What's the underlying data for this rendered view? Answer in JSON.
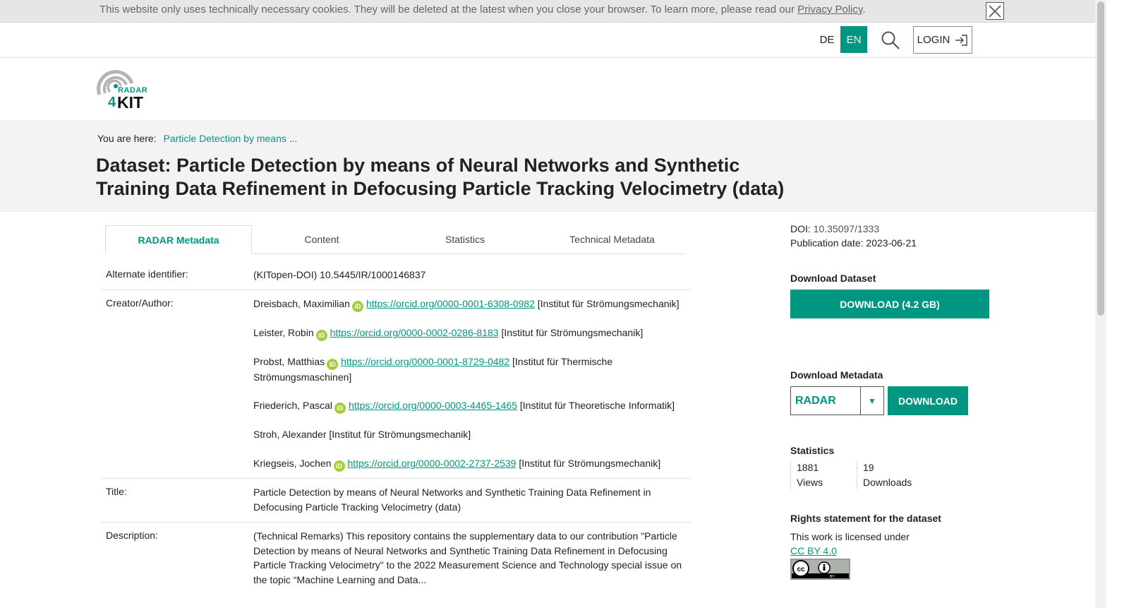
{
  "cookie": {
    "text": "This website only uses technically necessary cookies. They will be deleted at the latest when you close your browser. To learn more, please read our ",
    "link": "Privacy Policy",
    "suffix": "."
  },
  "topbar": {
    "lang_de": "DE",
    "lang_en": "EN",
    "login": "LOGIN"
  },
  "logo": {
    "line1": "RADAR",
    "line2a": "4",
    "line2b": "KIT"
  },
  "breadcrumb": {
    "prefix": "You are here:",
    "current": "Particle Detection by means",
    "ellipsis": "..."
  },
  "page_title": "Dataset: Particle Detection by means of Neural Networks and Synthetic Training Data Refinement in Defocusing Particle Tracking Velocimetry (data)",
  "tabs": [
    "RADAR Metadata",
    "Content",
    "Statistics",
    "Technical Metadata"
  ],
  "metadata": {
    "alternate_identifier_label": "Alternate identifier:",
    "alternate_identifier": "(KITopen-DOI) 10.5445/IR/1000146837",
    "creator_label": "Creator/Author:",
    "creators": [
      {
        "name": "Dreisbach, Maximilian",
        "orcid": "https://orcid.org/0000-0001-6308-0982",
        "affiliation": "[Institut für Strömungsmechanik]"
      },
      {
        "name": "Leister, Robin",
        "orcid": "https://orcid.org/0000-0002-0286-8183",
        "affiliation": "[Institut für Strömungsmechanik]"
      },
      {
        "name": "Probst, Matthias",
        "orcid": "https://orcid.org/0000-0001-8729-0482",
        "affiliation": "[Institut für Thermische Strömungsmaschinen]"
      },
      {
        "name": "Friederich, Pascal",
        "orcid": "https://orcid.org/0000-0003-4465-1465",
        "affiliation": "[Institut für Theoretische Informatik]"
      },
      {
        "name": "Stroh, Alexander",
        "orcid": "",
        "affiliation": "[Institut für Strömungsmechanik]"
      },
      {
        "name": "Kriegseis, Jochen",
        "orcid": "https://orcid.org/0000-0002-2737-2539",
        "affiliation": "[Institut für Strömungsmechanik]"
      }
    ],
    "title_label": "Title:",
    "title": "Particle Detection by means of Neural Networks and Synthetic Training Data Refinement in Defocusing Particle Tracking Velocimetry (data)",
    "description_label": "Description:",
    "description": "(Technical Remarks) This repository contains the supplementary data to our contribution \"Particle Detection by means of Neural Networks and Synthetic Training Data Refinement in Defocusing Particle Tracking Velocimetry\" to the 2022 Measurement Science and Technology special issue on the topic “Machine Learning and Data..."
  },
  "side": {
    "doi_label": "DOI:",
    "doi": "10.35097/1333",
    "pub_label": "Publication date:",
    "pub_date": "2023-06-21",
    "download_dataset_head": "Download Dataset",
    "download_dataset_btn": "DOWNLOAD (4.2 GB)",
    "download_metadata_head": "Download Metadata",
    "metadata_format": "RADAR",
    "download_btn": "DOWNLOAD",
    "statistics_head": "Statistics",
    "views_count": "1881",
    "views_label": "Views",
    "downloads_count": "19",
    "downloads_label": "Downloads",
    "rights_head": "Rights statement for the dataset",
    "license_text": "This work is licensed under",
    "license_link": "CC BY 4.0"
  },
  "colors": {
    "accent": "#009682",
    "orcid": "#a6ce39"
  }
}
